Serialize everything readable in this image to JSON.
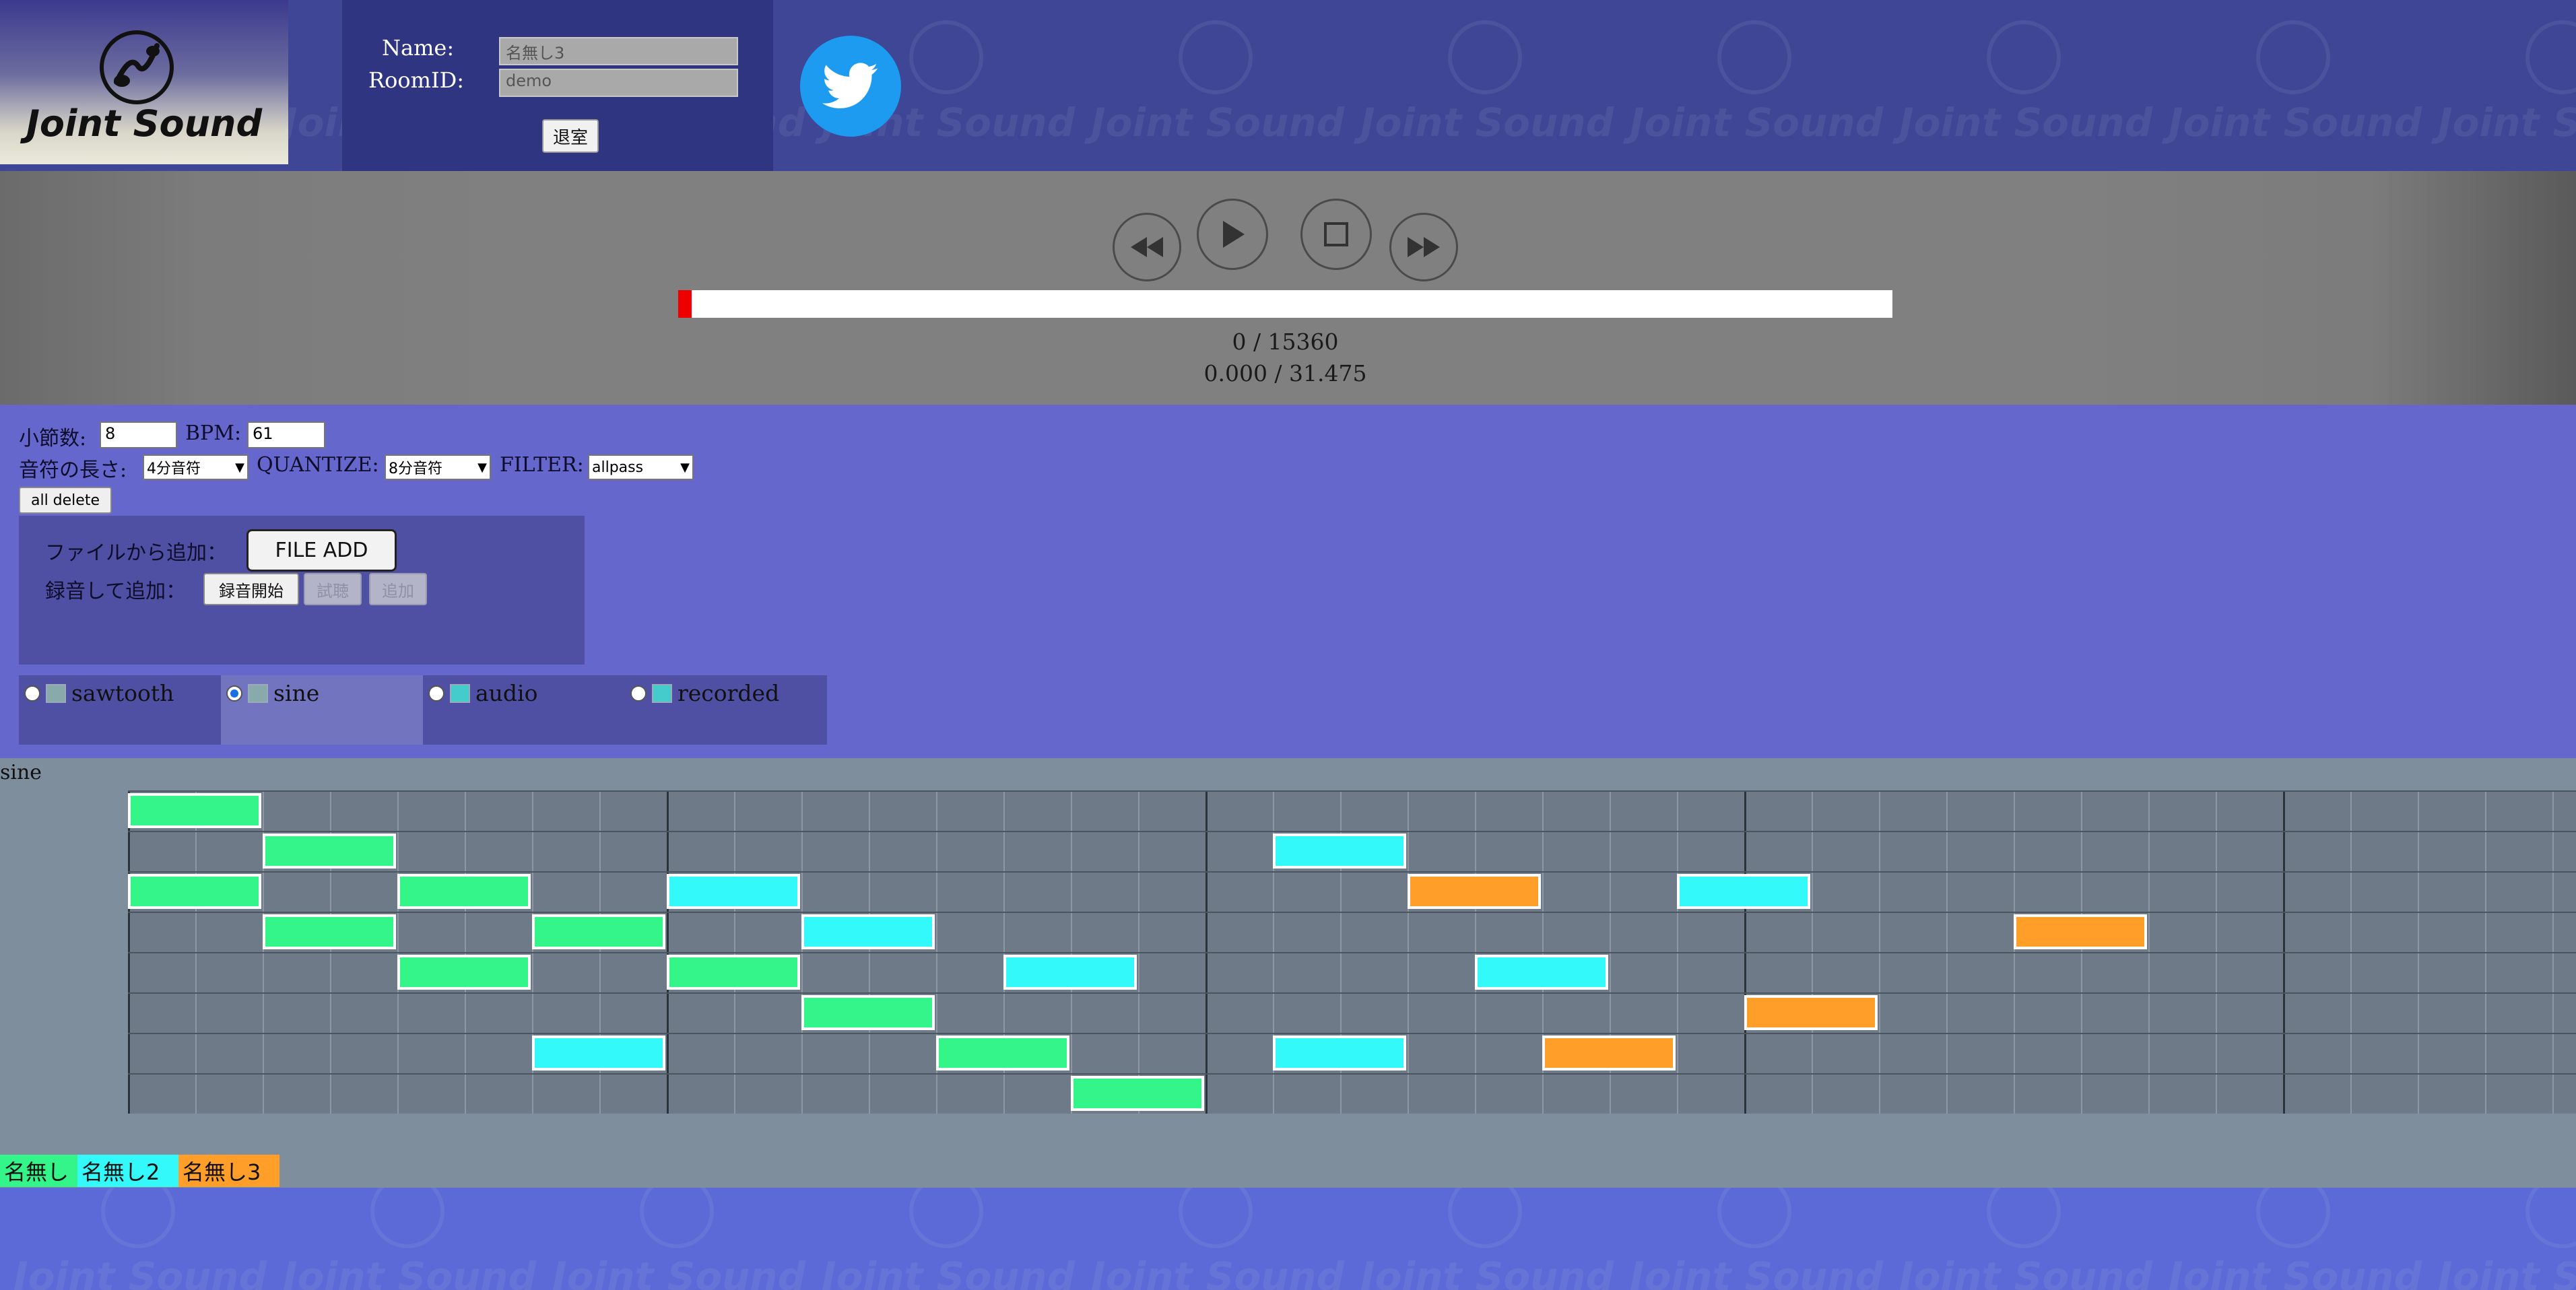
{
  "app": {
    "logo_text": "Joint Sound",
    "watermark_text": "Joint Sound"
  },
  "header": {
    "name_label": "Name:",
    "room_label": "RoomID:",
    "name_value": "名無し3",
    "room_value": "demo",
    "leave_label": "退室",
    "twitter_icon": "twitter-bird-icon"
  },
  "transport": {
    "icons": [
      "rewind-icon",
      "play-icon",
      "stop-icon",
      "fast-forward-icon"
    ],
    "position_ticks": "0 / 15360",
    "position_time": "0.000 / 31.475",
    "progress": 0.0
  },
  "controls": {
    "measures_label": "小節数:",
    "measures_value": "8",
    "bpm_label": "BPM:",
    "bpm_value": "61",
    "note_length_label": "音符の長さ:",
    "note_length_value": "4分音符",
    "quantize_label": "QUANTIZE:",
    "quantize_value": "8分音符",
    "filter_label": "FILTER:",
    "filter_value": "allpass",
    "all_delete_label": "all delete",
    "file_add_label": "ファイルから追加：",
    "file_add_button": "FILE ADD",
    "record_add_label": "録音して追加：",
    "record_start_button": "録音開始",
    "record_listen_button": "試聴",
    "record_add_button": "追加"
  },
  "waveforms": {
    "selected": "sine",
    "options": [
      {
        "label": "sawtooth",
        "checked": false
      },
      {
        "label": "sine",
        "checked": true
      },
      {
        "label": "audio",
        "checked": false
      },
      {
        "label": "recorded",
        "checked": false
      }
    ]
  },
  "roll": {
    "track_label": "sine",
    "rows": 8,
    "steps": 48,
    "beats_per_measure": 8,
    "colors": {
      "user1": "#33f58a",
      "user2": "#33f9fa",
      "user3": "#ff9f2a"
    },
    "notes": [
      {
        "user": "user1",
        "row": 0,
        "step": 0
      },
      {
        "user": "user1",
        "row": 1,
        "step": 2
      },
      {
        "user": "user1",
        "row": 2,
        "step": 0
      },
      {
        "user": "user1",
        "row": 2,
        "step": 4
      },
      {
        "user": "user1",
        "row": 3,
        "step": 2
      },
      {
        "user": "user1",
        "row": 3,
        "step": 6
      },
      {
        "user": "user1",
        "row": 4,
        "step": 4
      },
      {
        "user": "user1",
        "row": 4,
        "step": 8
      },
      {
        "user": "user1",
        "row": 5,
        "step": 10
      },
      {
        "user": "user1",
        "row": 6,
        "step": 12
      },
      {
        "user": "user1",
        "row": 7,
        "step": 14
      },
      {
        "user": "user2",
        "row": 2,
        "step": 8
      },
      {
        "user": "user2",
        "row": 3,
        "step": 10
      },
      {
        "user": "user2",
        "row": 4,
        "step": 13
      },
      {
        "user": "user2",
        "row": 6,
        "step": 6
      },
      {
        "user": "user2",
        "row": 1,
        "step": 17
      },
      {
        "user": "user2",
        "row": 6,
        "step": 17
      },
      {
        "user": "user2",
        "row": 4,
        "step": 20
      },
      {
        "user": "user2",
        "row": 2,
        "step": 23
      },
      {
        "user": "user3",
        "row": 2,
        "step": 19
      },
      {
        "user": "user3",
        "row": 6,
        "step": 21
      },
      {
        "user": "user3",
        "row": 5,
        "step": 24
      },
      {
        "user": "user3",
        "row": 3,
        "step": 28
      }
    ],
    "legend": [
      {
        "name": "名無し",
        "user": "user1"
      },
      {
        "name": "名無し2",
        "user": "user2"
      },
      {
        "name": "名無し3",
        "user": "user3"
      }
    ]
  }
}
